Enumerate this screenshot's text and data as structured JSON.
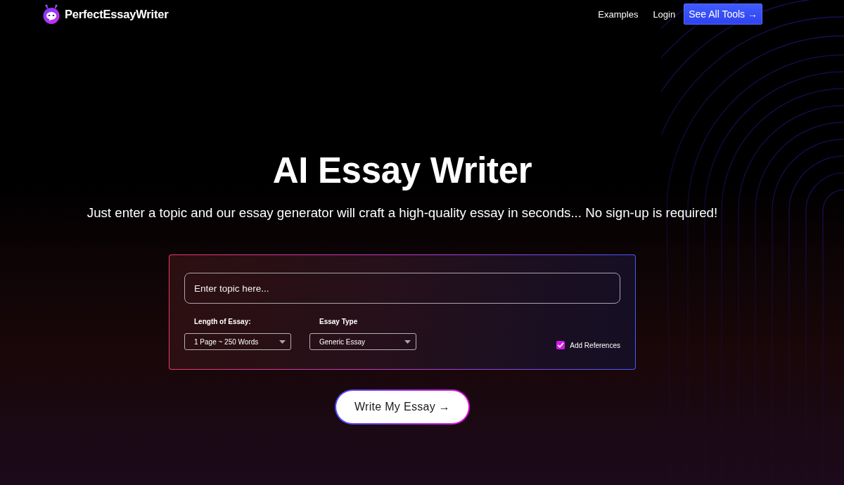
{
  "nav": {
    "logo_text": "PerfectEssayWriter",
    "links": [
      {
        "label": "Examples"
      },
      {
        "label": "Login"
      }
    ],
    "cta": "See All Tools →"
  },
  "hero": {
    "title": "AI Essay Writer",
    "subtitle": "Just enter a topic and our essay generator will craft a high-quality essay in seconds... No sign-up is required!"
  },
  "form": {
    "topic": {
      "placeholder": "Enter topic here..."
    },
    "selects": [
      {
        "label": "Length of Essay:",
        "value": "1 Page ~ 250 Words"
      },
      {
        "label": "Essay Type",
        "value": "Generic Essay"
      }
    ],
    "references": {
      "label": "Add References",
      "checked": true
    }
  },
  "submit": "Write My Essay →"
}
